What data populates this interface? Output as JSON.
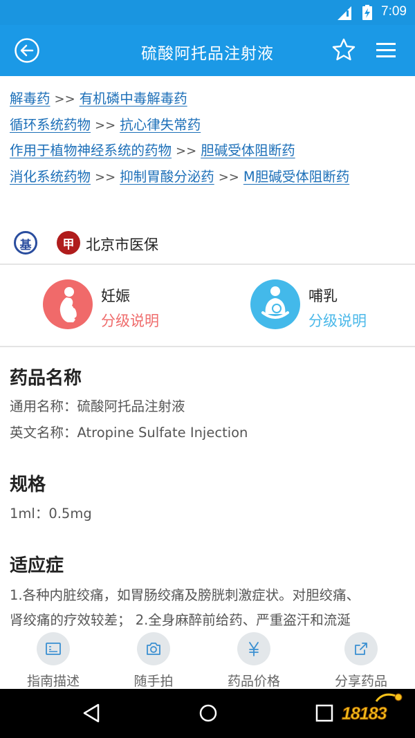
{
  "status_bar": {
    "time": "7:09"
  },
  "app_bar": {
    "title": "硫酸阿托品注射液"
  },
  "categories": [
    [
      "解毒药",
      "有机磷中毒解毒药"
    ],
    [
      "循环系统药物",
      "抗心律失常药"
    ],
    [
      "作用于植物神经系统的药物",
      "胆碱受体阻断药"
    ],
    [
      "消化系统药物",
      "抑制胃酸分泌药",
      "M胆碱受体阻断药"
    ]
  ],
  "separator": ">>",
  "insurance": {
    "badge_basic": "基",
    "badge_class": "甲",
    "label": "北京市医保"
  },
  "pregnancy": {
    "title": "妊娠",
    "subtitle": "分级说明"
  },
  "lactation": {
    "title": "哺乳",
    "subtitle": "分级说明"
  },
  "sections": {
    "name": {
      "title": "药品名称",
      "generic": "通用名称：硫酸阿托品注射液",
      "english": "英文名称：Atropine Sulfate Injection"
    },
    "spec": {
      "title": "规格",
      "value": "1ml：0.5mg"
    },
    "indications": {
      "title": "适应症",
      "line1": "1.各种内脏绞痛，如胃肠绞痛及膀胱刺激症状。对胆绞痛、",
      "line2": "肾绞痛的疗效较差； 2.全身麻醉前给药、严重盗汗和流涎"
    }
  },
  "toolbar": [
    {
      "label": "指南描述",
      "icon": "guide-icon"
    },
    {
      "label": "随手拍",
      "icon": "camera-icon"
    },
    {
      "label": "药品价格",
      "icon": "yuan-icon"
    },
    {
      "label": "分享药品",
      "icon": "share-icon"
    }
  ],
  "watermark": "18183",
  "colors": {
    "primary": "#1b99e6",
    "link": "#1c6fb8",
    "pregnancy": "#f06a6a",
    "lactation": "#43b9ea"
  }
}
